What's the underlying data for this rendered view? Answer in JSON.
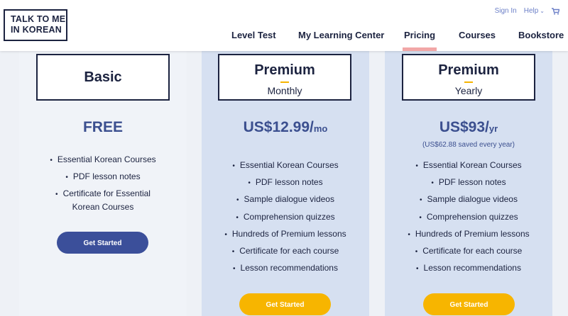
{
  "logo": {
    "line1": "TALK TO ME",
    "line2": "IN KOREAN"
  },
  "header": {
    "sign_in": "Sign In",
    "help": "Help",
    "cart_icon": "cart-icon"
  },
  "nav": {
    "items": [
      {
        "label": "Level Test"
      },
      {
        "label": "My Learning Center"
      },
      {
        "label": "Pricing",
        "active": true
      },
      {
        "label": "Courses"
      },
      {
        "label": "Bookstore"
      }
    ]
  },
  "plans": {
    "basic": {
      "title": "Basic",
      "price": "FREE",
      "features": [
        "Essential Korean Courses",
        "PDF lesson notes",
        "Certificate for Essential",
        "Korean Courses"
      ],
      "cta": "Get Started"
    },
    "monthly": {
      "title": "Premium",
      "subtitle": "Monthly",
      "price": "US$12.99/",
      "unit": "mo",
      "features": [
        "Essential Korean Courses",
        "PDF lesson notes",
        "Sample dialogue videos",
        "Comprehension quizzes",
        "Hundreds of Premium lessons",
        "Certificate for each course",
        "Lesson recommendations"
      ],
      "cta": "Get Started"
    },
    "yearly": {
      "title": "Premium",
      "subtitle": "Yearly",
      "price": "US$93/",
      "unit": "yr",
      "saved": "(US$62.88 saved every year)",
      "features": [
        "Essential Korean Courses",
        "PDF lesson notes",
        "Sample dialogue videos",
        "Comprehension quizzes",
        "Hundreds of Premium lessons",
        "Certificate for each course",
        "Lesson recommendations"
      ],
      "cta": "Get Started"
    }
  },
  "colors": {
    "navy": "#1c2340",
    "accent_blue": "#3b4f9a",
    "cta_yellow": "#f7b500",
    "active_underline": "#f2a7a7"
  }
}
